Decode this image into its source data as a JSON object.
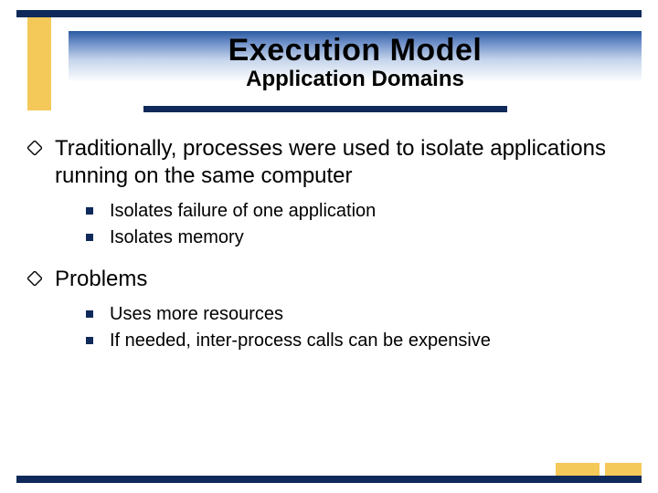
{
  "header": {
    "title": "Execution Model",
    "subtitle": "Application Domains"
  },
  "points": [
    {
      "text": "Traditionally, processes were used to isolate applications running on the same computer",
      "subs": [
        "Isolates failure of one application",
        "Isolates memory"
      ]
    },
    {
      "text": "Problems",
      "subs": [
        "Uses more resources",
        "If needed, inter-process calls can be expensive"
      ]
    }
  ],
  "colors": {
    "navy": "#0f2a5a",
    "yellow": "#f4c95a"
  }
}
